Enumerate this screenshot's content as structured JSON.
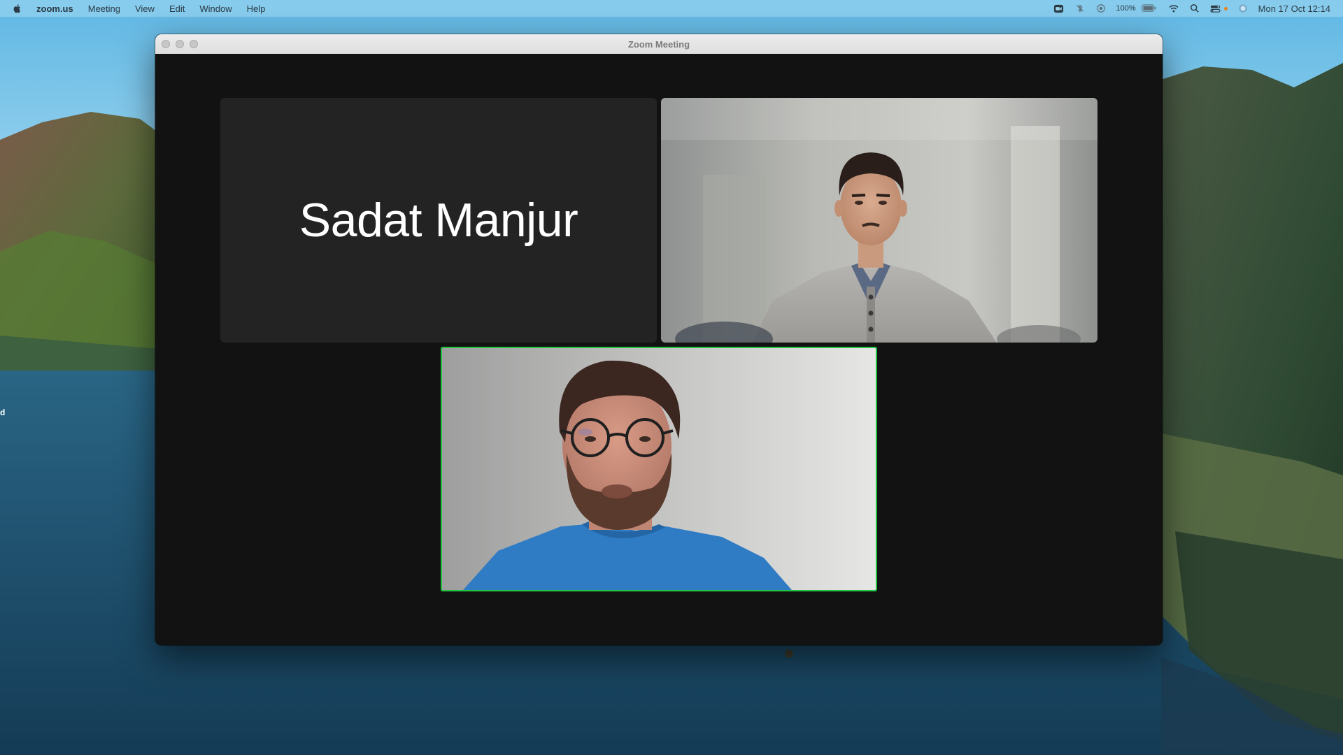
{
  "menubar": {
    "app_name": "zoom.us",
    "items": [
      "Meeting",
      "View",
      "Edit",
      "Window",
      "Help"
    ],
    "battery_percent": "100%",
    "clock": "Mon 17 Oct  12:14",
    "status_icons": [
      "zoom-video-icon",
      "bluetooth-off-icon",
      "screen-record-icon",
      "battery-icon",
      "wifi-icon",
      "spotlight-search-icon",
      "control-center-icon",
      "siri-icon"
    ]
  },
  "window": {
    "title": "Zoom Meeting",
    "participants": [
      {
        "name": "Sadat Manjur",
        "video_on": false
      },
      {
        "video_on": true,
        "avatar": "young-man-gray-sweater"
      },
      {
        "video_on": true,
        "active_speaker": true,
        "avatar": "bearded-man-glasses-blue-shirt"
      }
    ],
    "active_speaker_color": "#24c443"
  },
  "desktop": {
    "edge_label": "d"
  }
}
